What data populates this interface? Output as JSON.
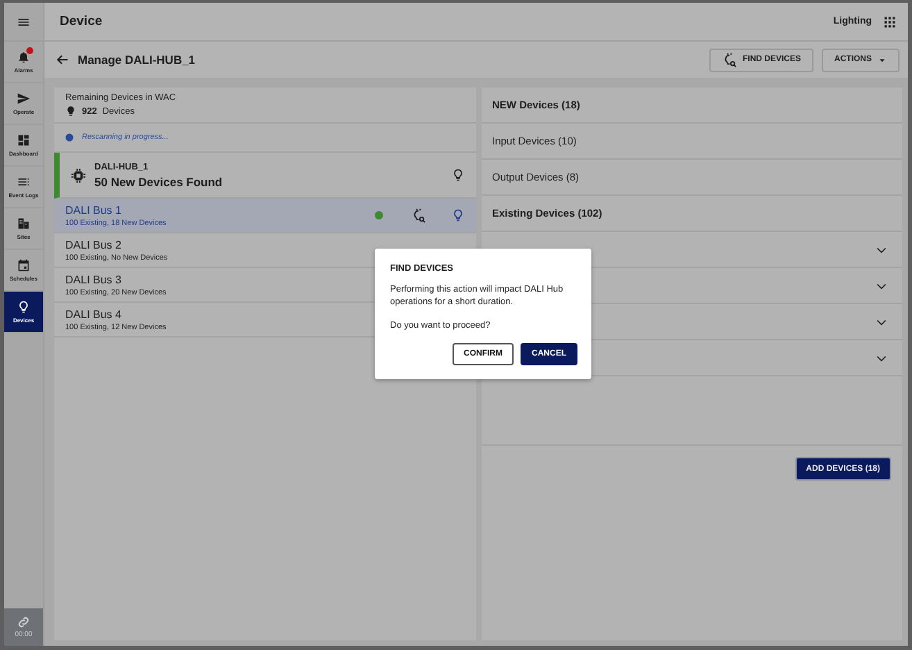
{
  "app": {
    "title": "Device",
    "module": "Lighting"
  },
  "nav": [
    {
      "label": "Alarms",
      "selected": false,
      "badge": true
    },
    {
      "label": "Operate",
      "selected": false,
      "badge": false
    },
    {
      "label": "Dashboard",
      "selected": false,
      "badge": false
    },
    {
      "label": "Event Logs",
      "selected": false,
      "badge": false
    },
    {
      "label": "Sites",
      "selected": false,
      "badge": false
    },
    {
      "label": "Schedules",
      "selected": false,
      "badge": false
    },
    {
      "label": "Devices",
      "selected": true,
      "badge": false
    }
  ],
  "connection": {
    "time": "00:00"
  },
  "page": {
    "title": "Manage DALI-HUB_1",
    "find_button": "FIND DEVICES",
    "actions_button": "ACTIONS"
  },
  "remaining": {
    "label": "Remaining Devices in WAC",
    "count": "922",
    "unit": "Devices"
  },
  "status": "Rescanning in progress...",
  "hub": {
    "name": "DALI-HUB_1",
    "found": "50 New Devices Found"
  },
  "buses": [
    {
      "name": "DALI Bus 1",
      "detail": "100 Existing, 18 New Devices",
      "selected": true
    },
    {
      "name": "DALI Bus 2",
      "detail": "100 Existing, No New Devices",
      "selected": false
    },
    {
      "name": "DALI Bus 3",
      "detail": "100 Existing, 20 New Devices",
      "selected": false
    },
    {
      "name": "DALI Bus 4",
      "detail": "100 Existing, 12 New Devices",
      "selected": false
    }
  ],
  "new_devices": {
    "title": "NEW Devices (18)",
    "items": [
      "Input Devices (10)",
      "Output Devices (8)"
    ]
  },
  "existing_devices": {
    "title": "Existing Devices (102)",
    "groups": [
      {
        "expanded": false
      },
      {
        "expanded": false
      },
      {
        "expanded": false
      },
      {
        "expanded": false
      }
    ]
  },
  "add_button": "ADD DEVICES (18)",
  "dialog": {
    "title": "FIND DEVICES",
    "message": "Performing this action will impact DALI Hub operations for a short duration.",
    "question": "Do you want to proceed?",
    "confirm": "CONFIRM",
    "cancel": "CANCEL"
  }
}
